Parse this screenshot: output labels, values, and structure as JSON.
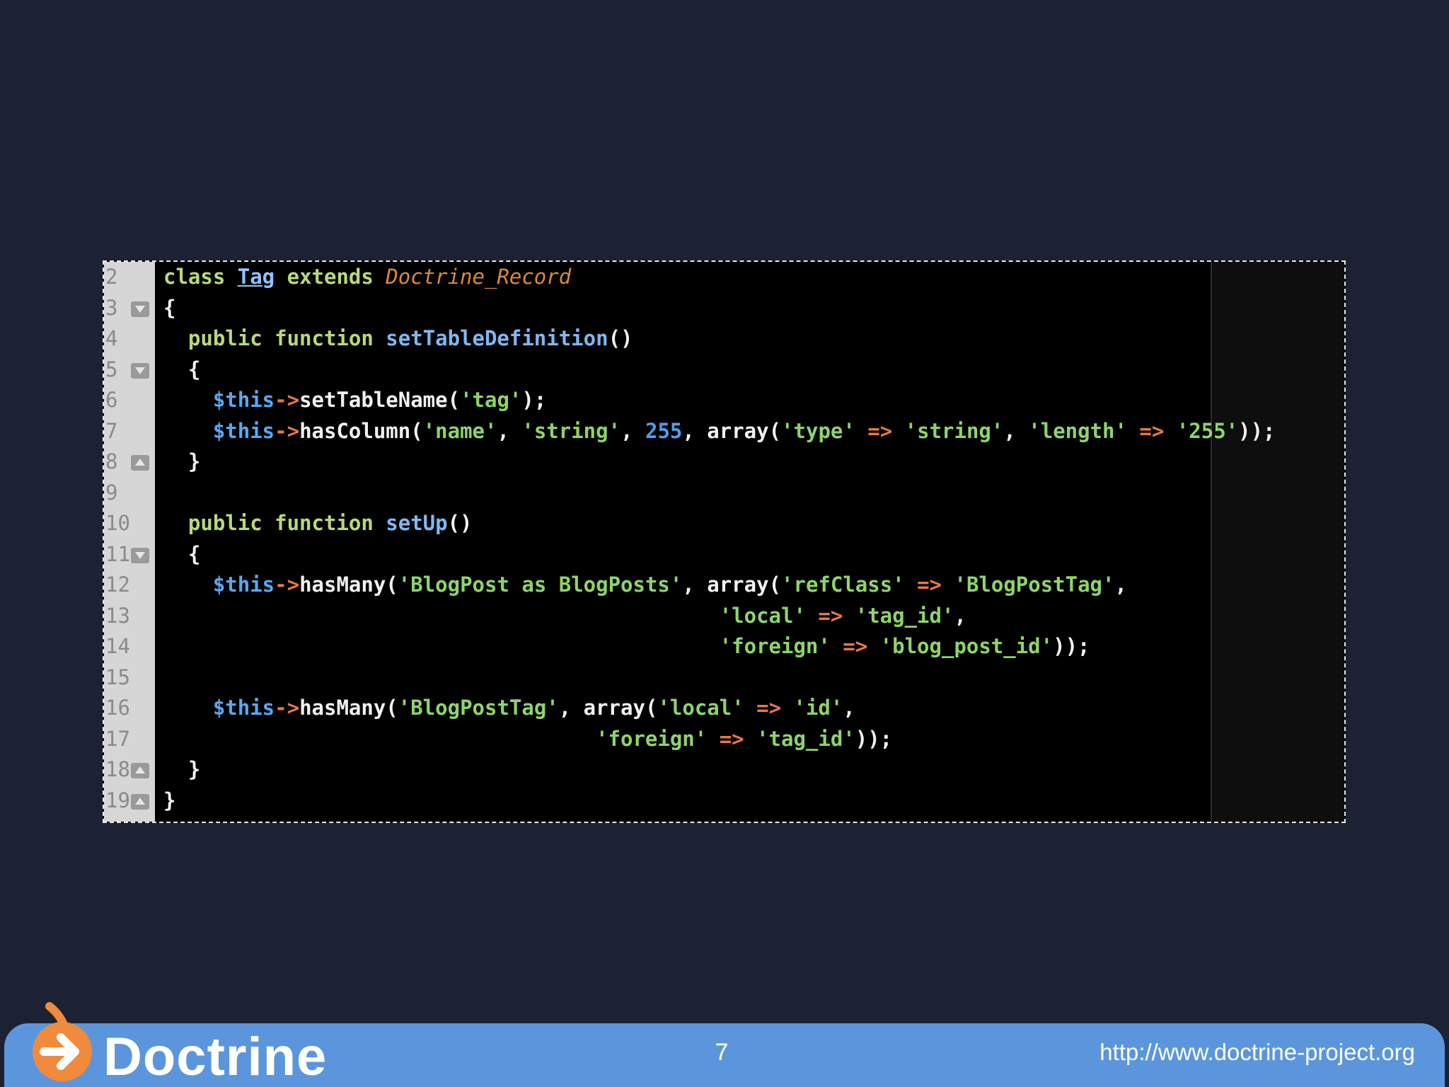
{
  "code": {
    "lines": [
      {
        "n": "2",
        "fold": "",
        "tokens": [
          [
            "kw",
            "class "
          ],
          [
            "cls",
            "Tag"
          ],
          [
            "kw",
            " extends "
          ],
          [
            "inh",
            "Doctrine_Record"
          ]
        ]
      },
      {
        "n": "3",
        "fold": "down",
        "tokens": [
          [
            "pl",
            "{"
          ]
        ]
      },
      {
        "n": "4",
        "fold": "",
        "tokens": [
          [
            "pl",
            "  "
          ],
          [
            "kw",
            "public function "
          ],
          [
            "fn",
            "setTableDefinition"
          ],
          [
            "pl",
            "()"
          ]
        ]
      },
      {
        "n": "5",
        "fold": "down",
        "tokens": [
          [
            "pl",
            "  {"
          ]
        ]
      },
      {
        "n": "6",
        "fold": "",
        "tokens": [
          [
            "pl",
            "    "
          ],
          [
            "var",
            "$this"
          ],
          [
            "op",
            "->"
          ],
          [
            "pl",
            "setTableName("
          ],
          [
            "str",
            "'tag'"
          ],
          [
            "pl",
            ");"
          ]
        ]
      },
      {
        "n": "7",
        "fold": "",
        "tokens": [
          [
            "pl",
            "    "
          ],
          [
            "var",
            "$this"
          ],
          [
            "op",
            "->"
          ],
          [
            "pl",
            "hasColumn("
          ],
          [
            "str",
            "'name'"
          ],
          [
            "pl",
            ", "
          ],
          [
            "str",
            "'string'"
          ],
          [
            "pl",
            ", "
          ],
          [
            "num",
            "255"
          ],
          [
            "pl",
            ", array("
          ],
          [
            "str",
            "'type'"
          ],
          [
            "op",
            " => "
          ],
          [
            "str",
            "'string'"
          ],
          [
            "pl",
            ", "
          ],
          [
            "str",
            "'length'"
          ],
          [
            "op",
            " => "
          ],
          [
            "str",
            "'255'"
          ],
          [
            "pl",
            "));"
          ]
        ]
      },
      {
        "n": "8",
        "fold": "up",
        "tokens": [
          [
            "pl",
            "  }"
          ]
        ]
      },
      {
        "n": "9",
        "fold": "",
        "tokens": []
      },
      {
        "n": "10",
        "fold": "",
        "tokens": [
          [
            "pl",
            "  "
          ],
          [
            "kw",
            "public function "
          ],
          [
            "fn",
            "setUp"
          ],
          [
            "pl",
            "()"
          ]
        ]
      },
      {
        "n": "11",
        "fold": "down",
        "tokens": [
          [
            "pl",
            "  {"
          ]
        ]
      },
      {
        "n": "12",
        "fold": "",
        "tokens": [
          [
            "pl",
            "    "
          ],
          [
            "var",
            "$this"
          ],
          [
            "op",
            "->"
          ],
          [
            "pl",
            "hasMany("
          ],
          [
            "str",
            "'BlogPost as BlogPosts'"
          ],
          [
            "pl",
            ", array("
          ],
          [
            "str",
            "'refClass'"
          ],
          [
            "op",
            " => "
          ],
          [
            "str",
            "'BlogPostTag'"
          ],
          [
            "pl",
            ","
          ]
        ]
      },
      {
        "n": "13",
        "fold": "",
        "tokens": [
          [
            "pl",
            "                                             "
          ],
          [
            "str",
            "'local'"
          ],
          [
            "op",
            " => "
          ],
          [
            "str",
            "'tag_id'"
          ],
          [
            "pl",
            ","
          ]
        ]
      },
      {
        "n": "14",
        "fold": "",
        "tokens": [
          [
            "pl",
            "                                             "
          ],
          [
            "str",
            "'foreign'"
          ],
          [
            "op",
            " => "
          ],
          [
            "str",
            "'blog_post_id'"
          ],
          [
            "pl",
            "));"
          ]
        ]
      },
      {
        "n": "15",
        "fold": "",
        "tokens": []
      },
      {
        "n": "16",
        "fold": "",
        "tokens": [
          [
            "pl",
            "    "
          ],
          [
            "var",
            "$this"
          ],
          [
            "op",
            "->"
          ],
          [
            "pl",
            "hasMany("
          ],
          [
            "str",
            "'BlogPostTag'"
          ],
          [
            "pl",
            ", array("
          ],
          [
            "str",
            "'local'"
          ],
          [
            "op",
            " => "
          ],
          [
            "str",
            "'id'"
          ],
          [
            "pl",
            ","
          ]
        ]
      },
      {
        "n": "17",
        "fold": "",
        "tokens": [
          [
            "pl",
            "                                   "
          ],
          [
            "str",
            "'foreign'"
          ],
          [
            "op",
            " => "
          ],
          [
            "str",
            "'tag_id'"
          ],
          [
            "pl",
            "));"
          ]
        ]
      },
      {
        "n": "18",
        "fold": "up",
        "tokens": [
          [
            "pl",
            "  }"
          ]
        ]
      },
      {
        "n": "19",
        "fold": "up",
        "tokens": [
          [
            "pl",
            "}"
          ]
        ]
      }
    ]
  },
  "footer": {
    "brand": "Doctrine",
    "page_number": "7",
    "url": "http://www.doctrine-project.org",
    "bar_color": "#5b96dd",
    "logo_color": "#f08a3c"
  }
}
